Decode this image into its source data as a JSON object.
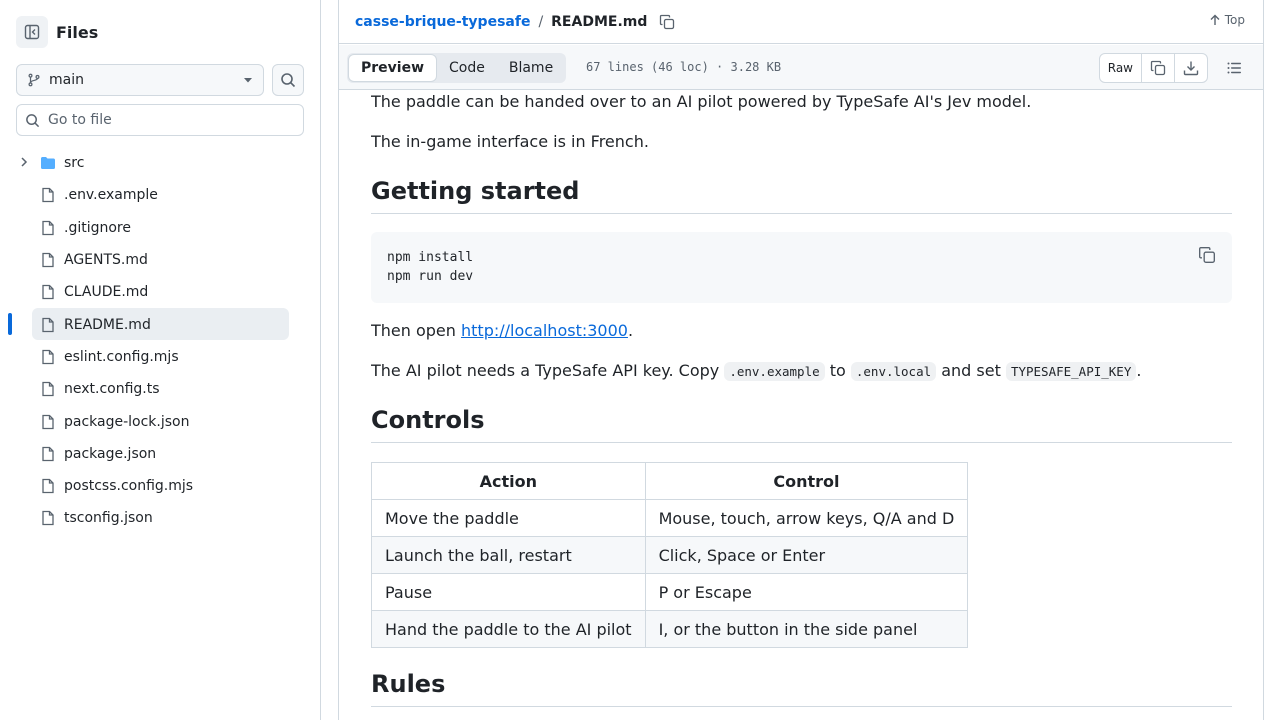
{
  "sidebar": {
    "title": "Files",
    "branch": "main",
    "goto_placeholder": "Go to file",
    "items": [
      {
        "name": "src",
        "type": "folder"
      },
      {
        "name": ".env.example",
        "type": "file"
      },
      {
        "name": ".gitignore",
        "type": "file"
      },
      {
        "name": "AGENTS.md",
        "type": "file"
      },
      {
        "name": "CLAUDE.md",
        "type": "file"
      },
      {
        "name": "README.md",
        "type": "file",
        "selected": true
      },
      {
        "name": "eslint.config.mjs",
        "type": "file"
      },
      {
        "name": "next.config.ts",
        "type": "file"
      },
      {
        "name": "package-lock.json",
        "type": "file"
      },
      {
        "name": "package.json",
        "type": "file"
      },
      {
        "name": "postcss.config.mjs",
        "type": "file"
      },
      {
        "name": "tsconfig.json",
        "type": "file"
      }
    ]
  },
  "header": {
    "repo": "casse-brique-typesafe",
    "separator": "/",
    "file": "README.md",
    "top_label": "Top"
  },
  "filebar": {
    "tabs": [
      "Preview",
      "Code",
      "Blame"
    ],
    "active_tab": "Preview",
    "meta": "67 lines (46 loc) · 3.28 KB",
    "raw_label": "Raw"
  },
  "readme": {
    "p1": "The paddle can be handed over to an AI pilot powered by TypeSafe AI's Jev model.",
    "p2": "The in-game interface is in French.",
    "h_getting_started": "Getting started",
    "code_line1": "npm install",
    "code_line2": "npm run dev",
    "then_open": "Then open ",
    "localhost": "http://localhost:3000",
    "period": ".",
    "api_pre": "The AI pilot needs a TypeSafe API key. Copy ",
    "api_code1": ".env.example",
    "api_to": " to ",
    "api_code2": ".env.local",
    "api_and": " and set ",
    "api_code3": "TYPESAFE_API_KEY",
    "api_end": ".",
    "h_controls": "Controls",
    "table": {
      "headers": [
        "Action",
        "Control"
      ],
      "rows": [
        [
          "Move the paddle",
          "Mouse, touch, arrow keys, Q/A and D"
        ],
        [
          "Launch the ball, restart",
          "Click, Space or Enter"
        ],
        [
          "Pause",
          "P or Escape"
        ],
        [
          "Hand the paddle to the AI pilot",
          "I, or the button in the side panel"
        ]
      ]
    },
    "h_rules": "Rules"
  },
  "colors": {
    "link": "#0969da",
    "folder": "#54aeff",
    "selected_bg": "#eaeef2",
    "border": "#d1d9e0"
  }
}
